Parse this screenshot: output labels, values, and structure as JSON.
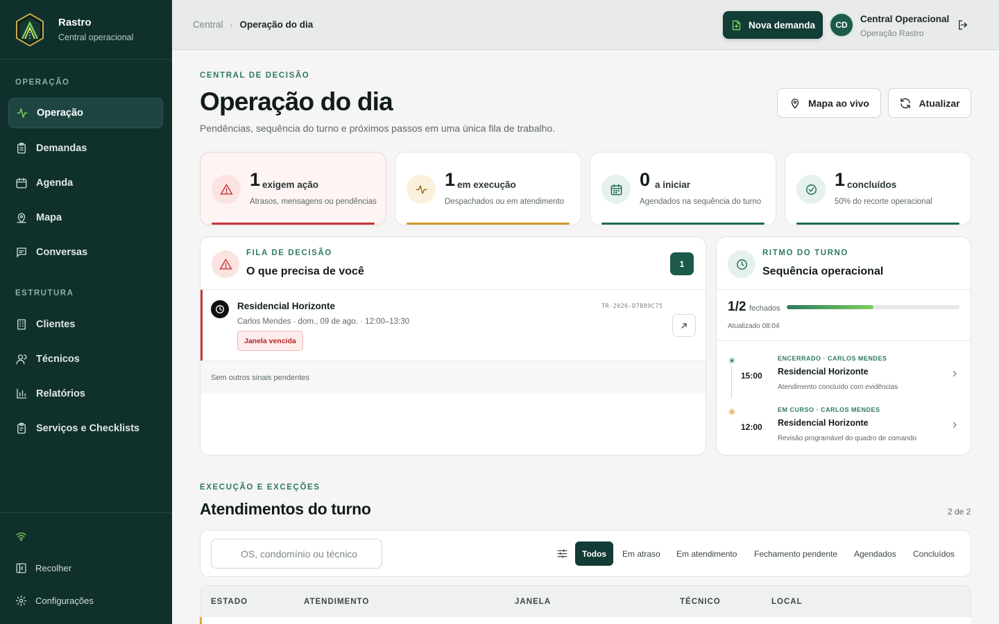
{
  "brand": {
    "name": "Rastro",
    "subtitle": "Central operacional"
  },
  "sidebar": {
    "section_operacao": "OPERAÇÃO",
    "section_estrutura": "ESTRUTURA",
    "items": [
      {
        "label": "Operação",
        "icon": "activity-icon",
        "active": true
      },
      {
        "label": "Demandas",
        "icon": "clipboard-icon"
      },
      {
        "label": "Agenda",
        "icon": "calendar-icon"
      },
      {
        "label": "Mapa",
        "icon": "map-pin-icon"
      },
      {
        "label": "Conversas",
        "icon": "message-icon"
      },
      {
        "label": "Clientes",
        "icon": "building-icon"
      },
      {
        "label": "Técnicos",
        "icon": "users-icon"
      },
      {
        "label": "Relatórios",
        "icon": "bar-chart-icon"
      },
      {
        "label": "Serviços e Checklists",
        "icon": "checklist-icon"
      }
    ],
    "collapse_label": "Recolher",
    "settings_label": "Configurações"
  },
  "topbar": {
    "breadcrumb_root": "Central",
    "breadcrumb_current": "Operação do dia",
    "new_button": "Nova demanda",
    "user_initials": "CD",
    "user_name": "Central Operacional",
    "user_org": "Operação Rastro"
  },
  "page": {
    "eyebrow": "CENTRAL DE DECISÃO",
    "title": "Operação do dia",
    "subtitle": "Pendências, sequência do turno e próximos passos em uma única fila de trabalho.",
    "map_button": "Mapa ao vivo",
    "refresh_button": "Atualizar"
  },
  "kpis": [
    {
      "value": "1",
      "label": "exigem ação",
      "desc": "Atrasos, mensagens ou pendências",
      "color": "#c4363a"
    },
    {
      "value": "1",
      "label": "em execução",
      "desc": "Despachados ou em atendimento",
      "color": "#d19a2e"
    },
    {
      "value": "0",
      "label": "a iniciar",
      "desc": "Agendados na sequência do turno",
      "color": "#1f6a55"
    },
    {
      "value": "1",
      "label": "concluídos",
      "desc": "50% do recorte operacional",
      "color": "#1f6a55"
    }
  ],
  "decision": {
    "eyebrow": "FILA DE DECISÃO",
    "title": "O que precisa de você",
    "count": "1",
    "item": {
      "title": "Residencial Horizonte",
      "meta": "Carlos Mendes · dom., 09 de ago. · 12:00–13:30",
      "tag": "Janela vencida",
      "code": "TR-2026-D7B89C75"
    },
    "footer": "Sem outros sinais pendentes"
  },
  "rhythm": {
    "eyebrow": "RITMO DO TURNO",
    "title": "Sequência operacional",
    "ratio": "1/2",
    "ratio_label": "fechados",
    "progress": 0.5,
    "updated": "Atualizado 08:04",
    "timeline": [
      {
        "time": "15:00",
        "status": "ENCERRADO · CARLOS MENDES",
        "title": "Residencial Horizonte",
        "desc": "Atendimento concluído com evidências",
        "dot": "#2e7a5e"
      },
      {
        "time": "12:00",
        "status": "EM CURSO · CARLOS MENDES",
        "title": "Residencial Horizonte",
        "desc": "Revisão programável do quadro de comando",
        "dot": "#e0a341"
      }
    ]
  },
  "execution": {
    "eyebrow": "EXECUÇÃO E EXCEÇÕES",
    "title": "Atendimentos do turno",
    "count": "2 de 2",
    "search_placeholder": "OS, condomínio ou técnico",
    "filters": [
      "Todos",
      "Em atraso",
      "Em atendimento",
      "Fechamento pendente",
      "Agendados",
      "Concluídos"
    ],
    "columns": [
      "ESTADO",
      "ATENDIMENTO",
      "JANELA",
      "TÉCNICO",
      "LOCAL"
    ]
  }
}
